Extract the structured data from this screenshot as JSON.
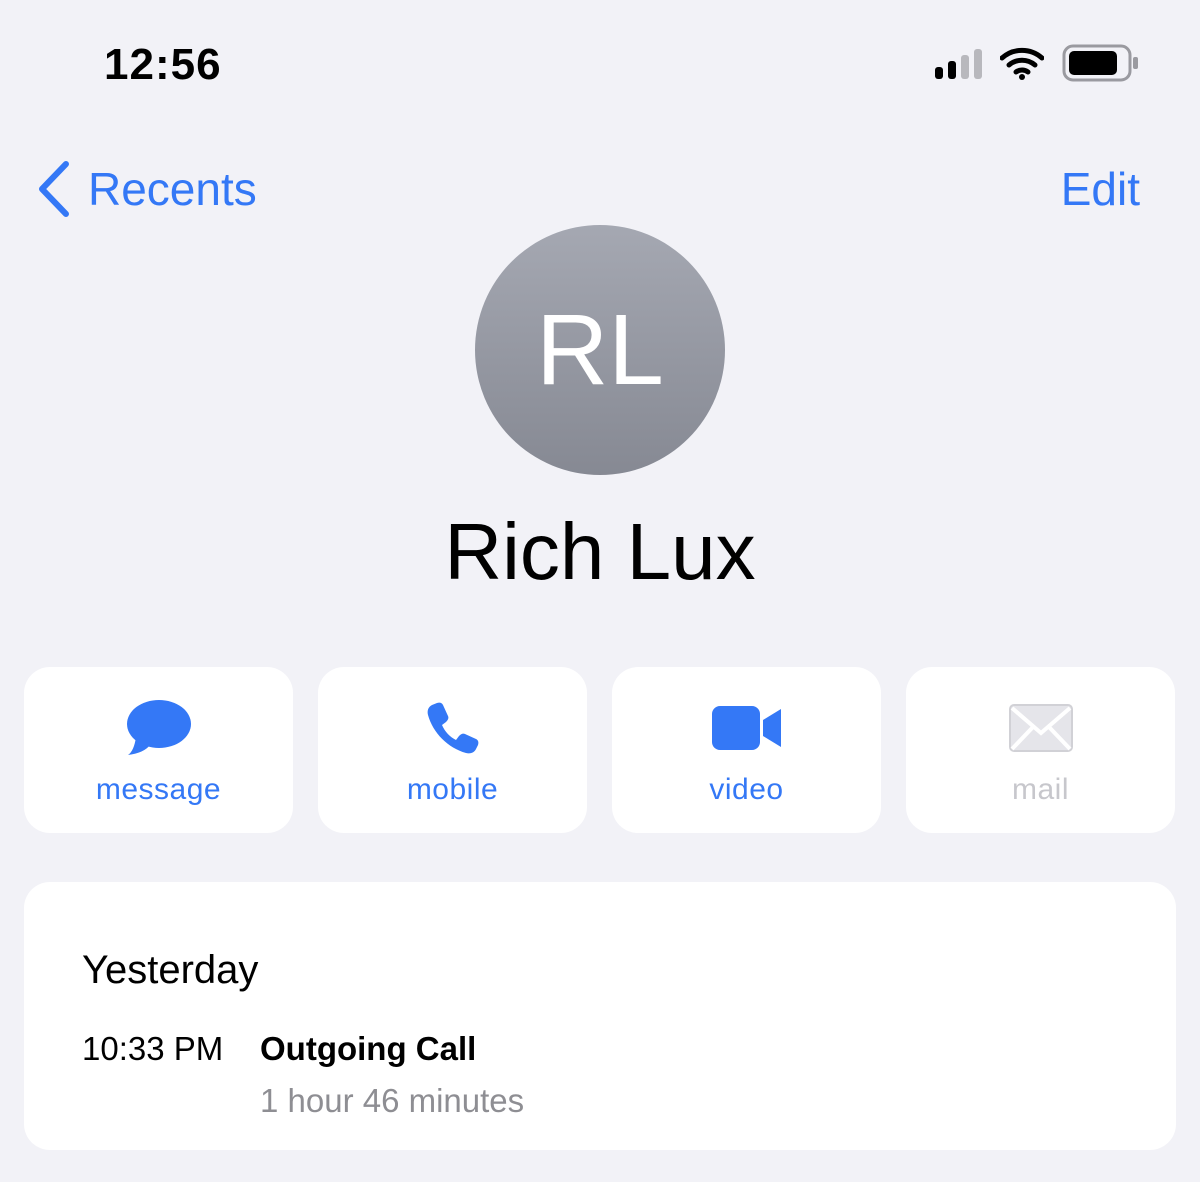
{
  "status_bar": {
    "time": "12:56",
    "icons": [
      "cellular-signal-icon",
      "wifi-icon",
      "battery-icon"
    ]
  },
  "nav": {
    "back_label": "Recents",
    "edit_label": "Edit",
    "accent_color": "#3478f6"
  },
  "contact": {
    "initials": "RL",
    "name": "Rich Lux"
  },
  "actions": [
    {
      "label": "message",
      "icon": "message-bubble-icon",
      "enabled": true
    },
    {
      "label": "mobile",
      "icon": "phone-icon",
      "enabled": true
    },
    {
      "label": "video",
      "icon": "video-camera-icon",
      "enabled": true
    },
    {
      "label": "mail",
      "icon": "mail-envelope-icon",
      "enabled": false
    }
  ],
  "call_history": {
    "day": "Yesterday",
    "entries": [
      {
        "time": "10:33 PM",
        "type": "Outgoing Call",
        "duration": "1 hour 46 minutes"
      }
    ]
  }
}
